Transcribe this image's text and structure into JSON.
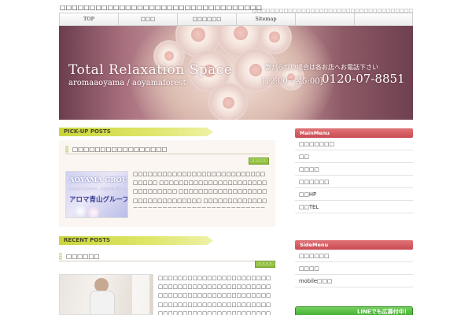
{
  "header": {
    "site_title": "□□□□□□□□□□□□□□□□□□□□□□□□□□□□□□□□□□",
    "description": "□□□□□□□□□□□□□□□□□□□□□□□□□□□□□□□□□□□□"
  },
  "nav": {
    "items": [
      {
        "label": "TOP"
      },
      {
        "label": "□□□"
      },
      {
        "label": "□□□□□□"
      },
      {
        "label": "Sitemap"
      },
      {
        "label": ""
      },
      {
        "label": ""
      }
    ]
  },
  "hero": {
    "title": "Total Relaxation Space",
    "subtitle": "aromaaoyama / aoyamaforest",
    "notice": "繋がらない場合は各お店へお電話下さい",
    "hours": "[12:00~翌5:00]",
    "phone": "0120-07-8851"
  },
  "pickup": {
    "heading": "PICK-UP POSTS",
    "post_title": "□□□□□□□□□□□□□□□□□",
    "date_badge": "□□□□□",
    "thumb": {
      "brand": "AOYAMA GROUP",
      "script": "Aroma Aoyama · Aoyama Forest",
      "caption": "アロマ青山グループ"
    },
    "excerpt": "□□□□□□□□□□□□□□□□□□□□□□□□□□□□□□□□ □□□□□□□□□□□□□□□□□□□□□□□□□□□□□□□ □□□□□□□□□□□□□□□□□□□□□□□□□□□□□□□□ □□□□□□□□□□□□□□□□□□□□□□□□□□□□□□□□□□□□□□□□□□□□□□□□□□□□□□□□□□□□□□□□□□□□□□□□□□…"
  },
  "recent": {
    "heading": "RECENT POSTS",
    "post_title": "□□□□□□",
    "date_badge": "□□□□□",
    "excerpt": "□□□□□□□□□□□□□□□□□□□□□□□□□□□□□□□□□□□□□□□□□□□□□□□□□□□□□□□□□□□□□□□□□□□□□□□□□□□□□□□□□□□□□□□□□□□□□□□□□□□□□□□□□□□□□□□□□□□□□□□□□□□□□",
    "more_link": "□□□□□□"
  },
  "sidebar": {
    "main_heading": "MainMenu",
    "main_items": [
      {
        "label": "□□□□□□□"
      },
      {
        "label": "□□"
      },
      {
        "label": "□□□□"
      },
      {
        "label": "□□□□□□"
      },
      {
        "label": "□□HP"
      },
      {
        "label": "□□TEL"
      }
    ],
    "side_heading": "SideMenu",
    "side_items": [
      {
        "label": "□□□□□□"
      },
      {
        "label": "□□□□"
      },
      {
        "label": "mobile□□□"
      }
    ],
    "line_banner": "LINEでも広募付中！"
  },
  "colors": {
    "accent_green": "#c9d63a",
    "sidebar_red": "#d0585e",
    "date_green": "#8fbf3a",
    "link_blue": "#2a7fc1"
  }
}
